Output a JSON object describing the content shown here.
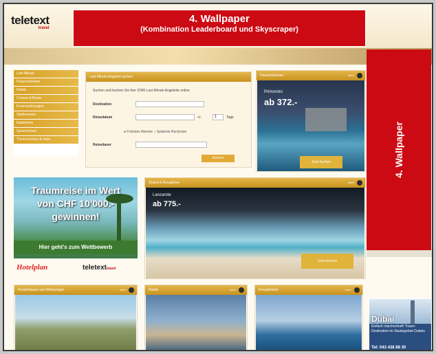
{
  "logo": {
    "text": "teletext",
    "sub": "travel"
  },
  "leaderboard": {
    "title": "4. Wallpaper",
    "subtitle": "(Kombination Leaderboard und Skyscraper)"
  },
  "skyscraper": {
    "label": "4. Wallpaper"
  },
  "nav": {
    "items": [
      "Last Minute",
      "Pauschalreisen",
      "Hotels",
      "Cruises & Boote",
      "Ferienwohnungen",
      "Städtereisen",
      "Badeferien",
      "Sprachreisen",
      "Themenreisen & more"
    ]
  },
  "search": {
    "title": "Last Minute Angebot suchen",
    "intro": "Suchen und buchen Sie hier 3'000 Last Minute Angebote online",
    "label_destination": "Destination",
    "label_date": "Reisedatum",
    "date_suffix": "+/-",
    "date_select": "1",
    "date_unit": "Tage",
    "radio_1": "Frühstes Abreise",
    "radio_2": "Späteste Rückreise",
    "label_duration": "Reisedauer",
    "button": "Suchen"
  },
  "promo": {
    "title": "Pauschalreisen",
    "more": "mehr",
    "place": "Primorsko",
    "price": "ab 372.-",
    "button": "Jetzt buchen"
  },
  "contest": {
    "line1": "Traumreise im Wert",
    "line2": "von CHF 10'000.-",
    "line3": "gewinnen!",
    "bar": "Hier geht's zum Wettbewerb"
  },
  "brands": {
    "b1": "Hotelplan",
    "b2": "teletext",
    "b2_sub": "travel"
  },
  "beach": {
    "title": "Strand & Bungalows",
    "more": "mehr",
    "place": "Lanzarote",
    "price": "ab 775.-",
    "button": "Jetzt buchen"
  },
  "cards": [
    {
      "title": "Ferienhäuser und Wohnungen",
      "more": "mehr"
    },
    {
      "title": "Hotels",
      "more": "mehr"
    },
    {
      "title": "Kreuzfahrten",
      "more": "mehr"
    }
  ],
  "dubai": {
    "title": "Dubai",
    "sub": "Einfach märchenhaft! Traum-Destination im Staatsgebiet Dubais",
    "tel": "Tel: 043 438 88 30"
  }
}
